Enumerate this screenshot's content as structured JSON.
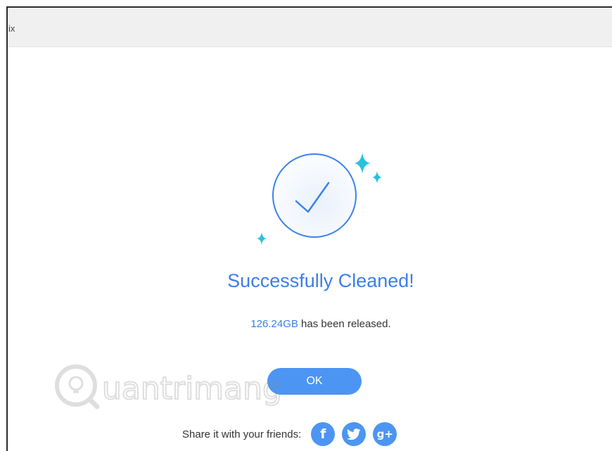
{
  "window": {
    "title": "ix"
  },
  "result": {
    "title": "Successfully Cleaned!",
    "amount": "126.24GB",
    "released_text": " has been released."
  },
  "buttons": {
    "ok_label": "OK"
  },
  "share": {
    "label": "Share it with your friends:",
    "facebook_glyph": "f",
    "twitter_icon": "twitter-bird-icon",
    "googleplus_glyph": "g+"
  },
  "watermark": {
    "text": "uantrimang"
  },
  "colors": {
    "accent": "#3b7fe6",
    "button": "#4c95f3",
    "sparkle": "#27c2dd",
    "titlebar": "#f0f0f0"
  }
}
